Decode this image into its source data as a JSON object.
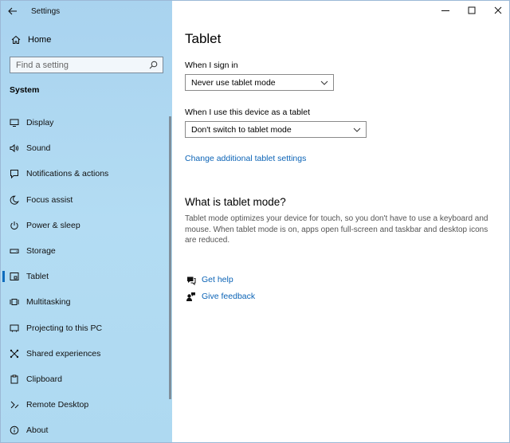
{
  "app": {
    "title": "Settings"
  },
  "sidebar": {
    "home_label": "Home",
    "search_placeholder": "Find a setting",
    "section": "System",
    "items": [
      {
        "label": "Display",
        "icon": "display-icon"
      },
      {
        "label": "Sound",
        "icon": "speaker-icon"
      },
      {
        "label": "Notifications & actions",
        "icon": "notifications-icon"
      },
      {
        "label": "Focus assist",
        "icon": "moon-icon"
      },
      {
        "label": "Power & sleep",
        "icon": "power-icon"
      },
      {
        "label": "Storage",
        "icon": "storage-icon"
      },
      {
        "label": "Tablet",
        "icon": "tablet-icon",
        "selected": true
      },
      {
        "label": "Multitasking",
        "icon": "multitasking-icon"
      },
      {
        "label": "Projecting to this PC",
        "icon": "projecting-icon"
      },
      {
        "label": "Shared experiences",
        "icon": "shared-experiences-icon"
      },
      {
        "label": "Clipboard",
        "icon": "clipboard-icon"
      },
      {
        "label": "Remote Desktop",
        "icon": "remote-desktop-icon"
      },
      {
        "label": "About",
        "icon": "info-icon"
      }
    ]
  },
  "main": {
    "title": "Tablet",
    "sign_in": {
      "label": "When I sign in",
      "value": "Never use tablet mode"
    },
    "as_tablet": {
      "label": "When I use this device as a tablet",
      "value": "Don't switch to tablet mode"
    },
    "additional_link": "Change additional tablet settings",
    "what_heading": "What is tablet mode?",
    "what_text": "Tablet mode optimizes your device for touch, so you don't have to use a keyboard and mouse. When tablet mode is on, apps open full-screen and taskbar and desktop icons are reduced.",
    "help_links": [
      {
        "label": "Get help",
        "icon": "help-chat-icon"
      },
      {
        "label": "Give feedback",
        "icon": "feedback-icon"
      }
    ]
  },
  "colors": {
    "accent": "#0b63b6",
    "sidebar_bg": "#aed8f1",
    "selection_bar": "#0f6cbd"
  }
}
